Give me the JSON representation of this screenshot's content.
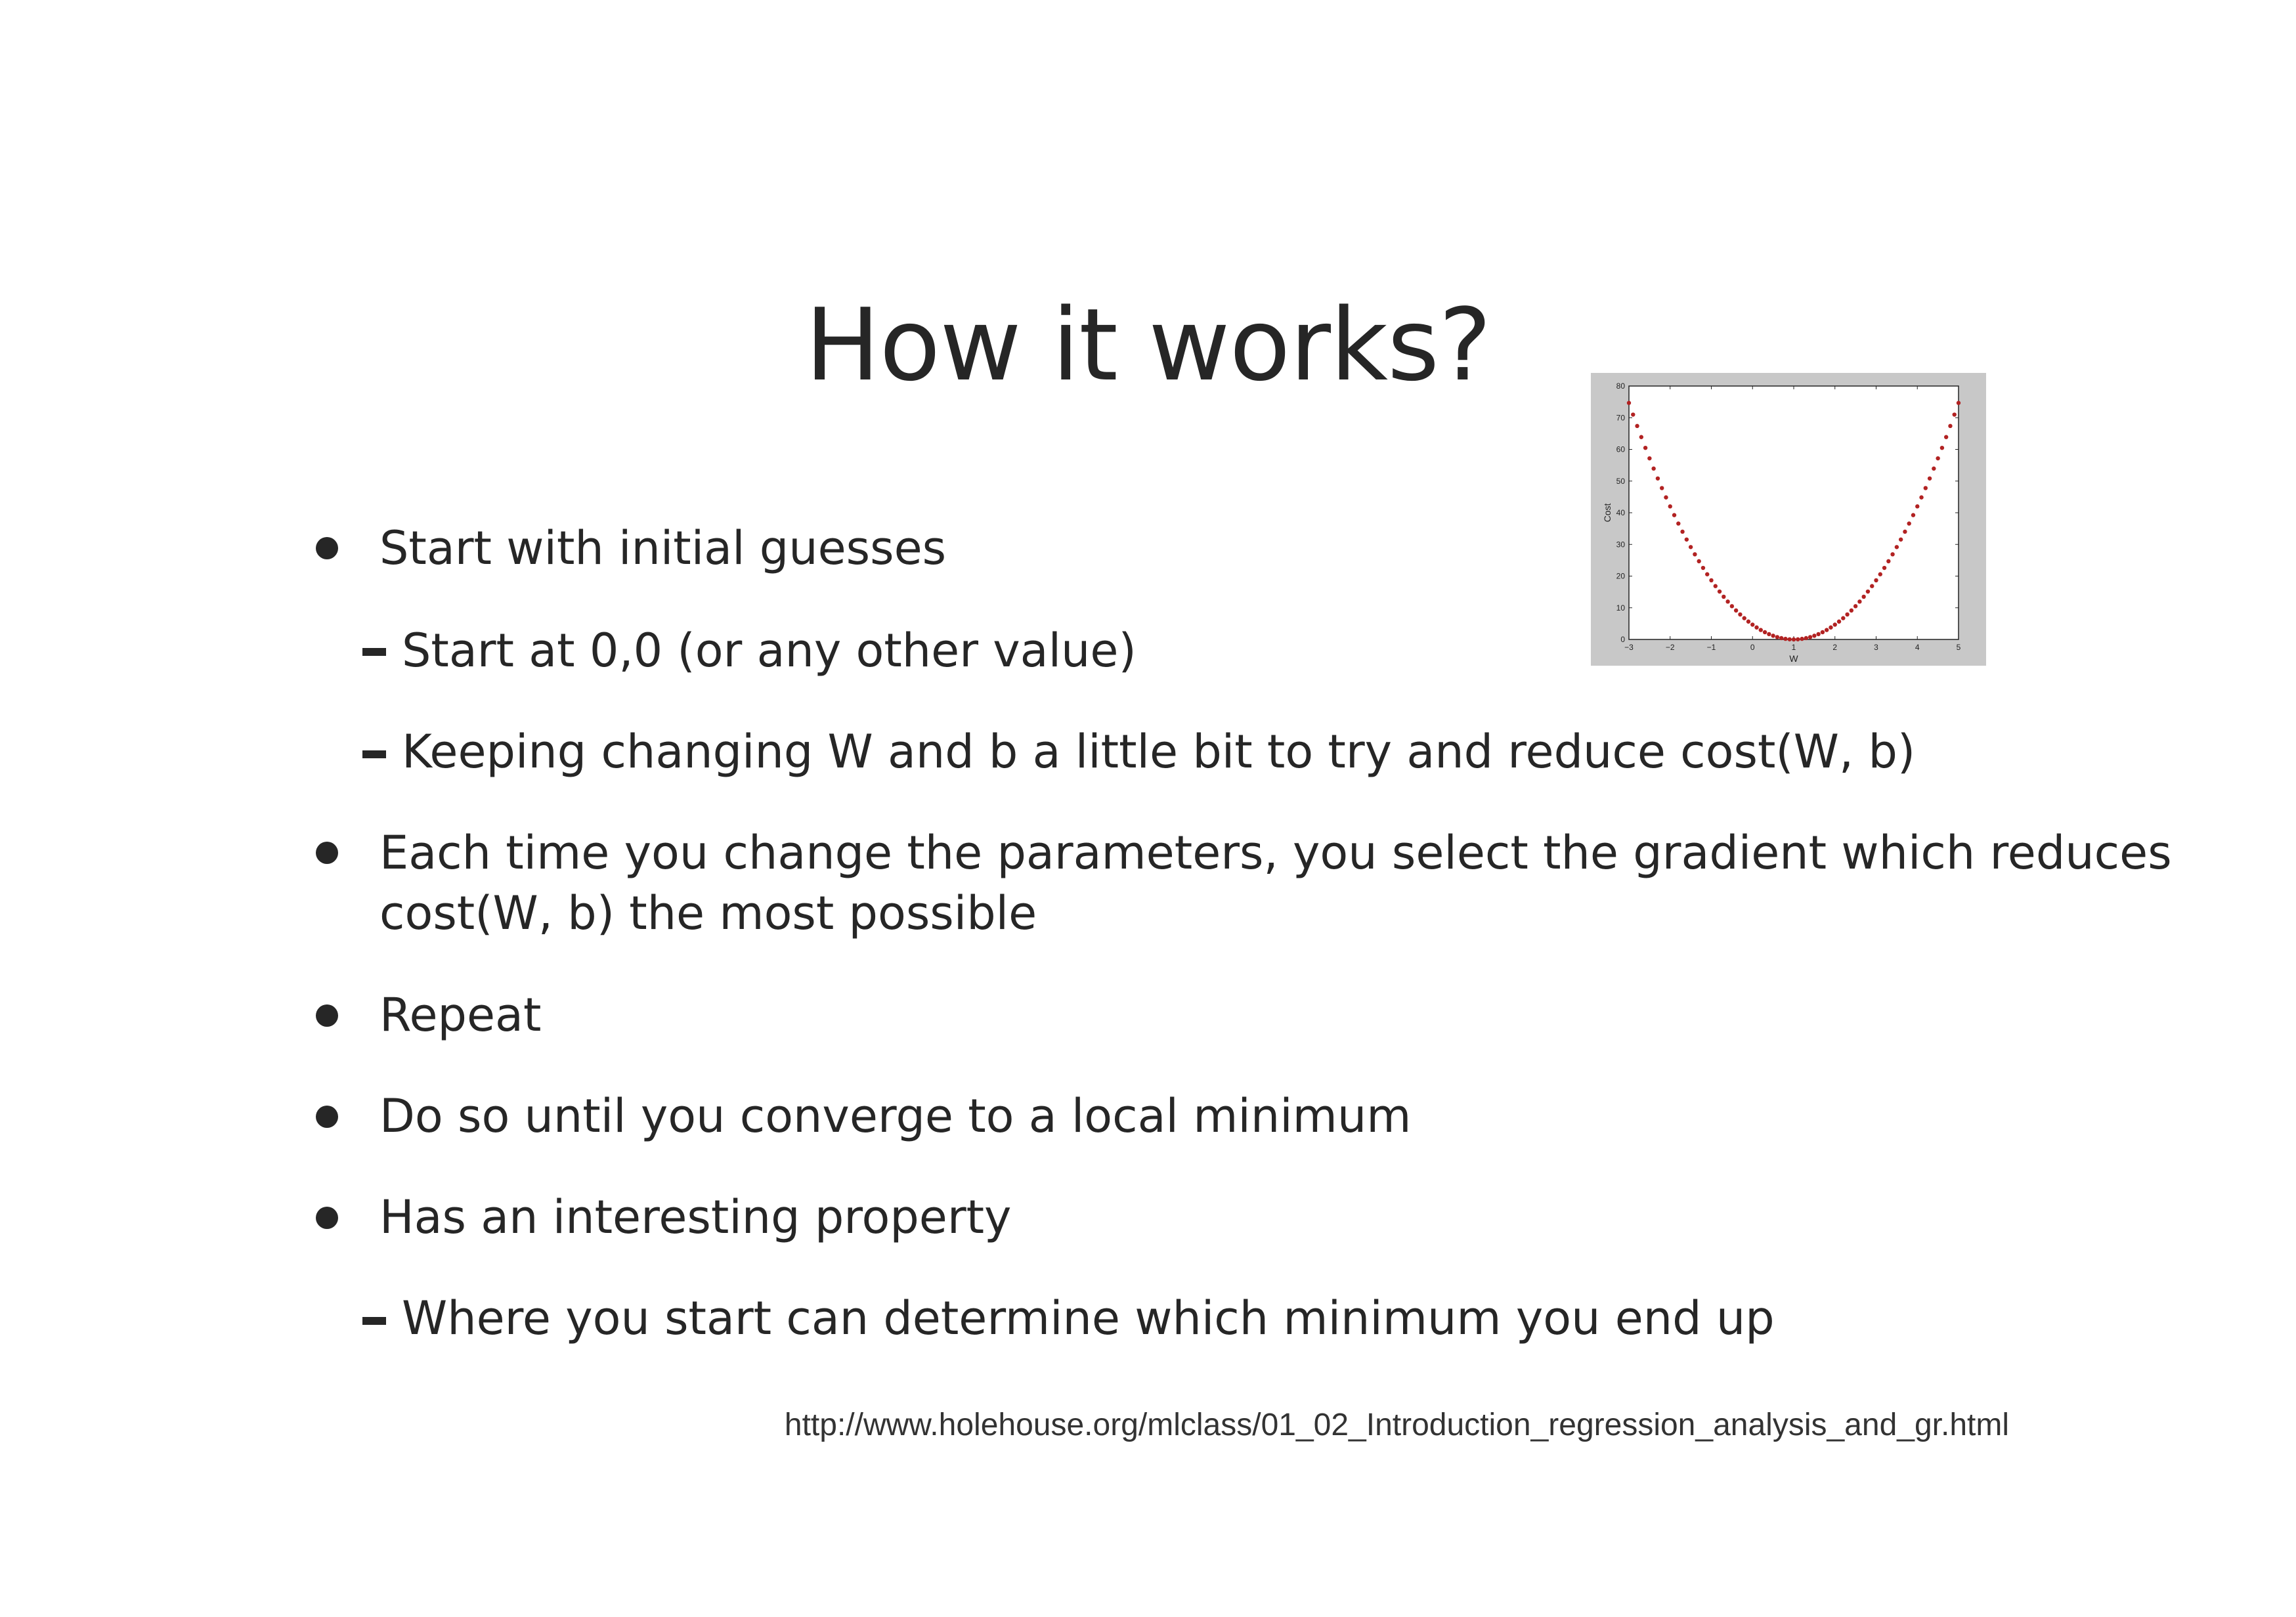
{
  "slide": {
    "title": "How it works?",
    "bullets": [
      {
        "level": 1,
        "text": "Start with initial guesses"
      },
      {
        "level": 2,
        "text": "Start at 0,0 (or any other value)"
      },
      {
        "level": 2,
        "text": "Keeping changing W and b a little bit to try and reduce cost(W, b)"
      },
      {
        "level": 1,
        "text": "Each time you change the parameters, you select the gradient which reduces",
        "continuation": "cost(W, b) the most possible"
      },
      {
        "level": 1,
        "text": "Repeat"
      },
      {
        "level": 1,
        "text": "Do so until you converge to a local minimum"
      },
      {
        "level": 1,
        "text": "Has an interesting property"
      },
      {
        "level": 2,
        "text": "Where you start can determine which minimum you end up"
      }
    ],
    "source": "http://www.holehouse.org/mlclass/01_02_Introduction_regression_analysis_and_gr.html"
  },
  "chart_data": {
    "type": "scatter",
    "xlabel": "W",
    "ylabel": "Cost",
    "xlim": [
      -3,
      5
    ],
    "ylim": [
      0,
      80
    ],
    "xticks": [
      "-3",
      "-2",
      "-1",
      "0",
      "1",
      "2",
      "3",
      "4",
      "5"
    ],
    "yticks": [
      "0",
      "10",
      "20",
      "30",
      "40",
      "50",
      "60",
      "70",
      "80"
    ],
    "grid": false,
    "marker_color": "#b22222",
    "frame_color": "#c8c8c8",
    "series": [
      {
        "values_formula": "4.6667*(W-1)^2",
        "x": [
          -3.0,
          -2.9,
          -2.8,
          -2.7,
          -2.6,
          -2.5,
          -2.4,
          -2.3,
          -2.2,
          -2.1,
          -2.0,
          -1.9,
          -1.8,
          -1.7,
          -1.6,
          -1.5,
          -1.4,
          -1.3,
          -1.2,
          -1.1,
          -1.0,
          -0.9,
          -0.8,
          -0.7,
          -0.6,
          -0.5,
          -0.4,
          -0.3,
          -0.2,
          -0.1,
          0.0,
          0.1,
          0.2,
          0.3,
          0.4,
          0.5,
          0.6,
          0.7,
          0.8,
          0.9,
          1.0,
          1.1,
          1.2,
          1.3,
          1.4,
          1.5,
          1.6,
          1.7,
          1.8,
          1.9,
          2.0,
          2.1,
          2.2,
          2.3,
          2.4,
          2.5,
          2.6,
          2.7,
          2.8,
          2.9,
          3.0,
          3.1,
          3.2,
          3.3,
          3.4,
          3.5,
          3.6,
          3.7,
          3.8,
          3.9,
          4.0,
          4.1,
          4.2,
          4.3,
          4.4,
          4.5,
          4.6,
          4.7,
          4.8,
          4.9,
          5.0
        ]
      }
    ]
  }
}
